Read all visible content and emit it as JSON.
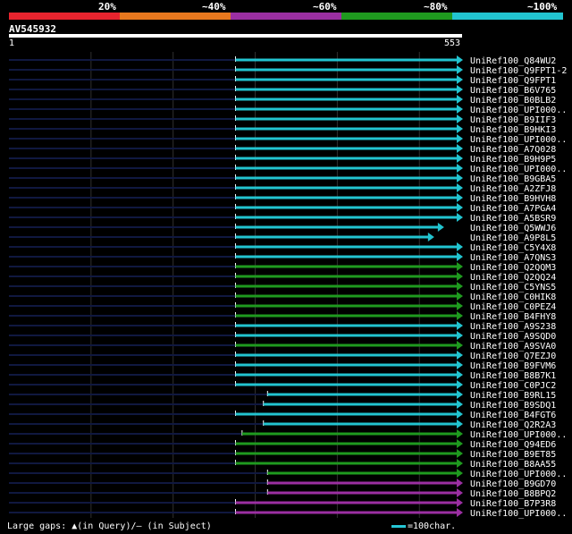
{
  "legend": {
    "segments": [
      {
        "label": "20%",
        "color": "#e8242e"
      },
      {
        "label": "~40%",
        "color": "#e8781e"
      },
      {
        "label": "~60%",
        "color": "#9b2fa2"
      },
      {
        "label": "~80%",
        "color": "#1f9a1f"
      },
      {
        "label": "~100%",
        "color": "#22c4d0"
      }
    ]
  },
  "query": {
    "id": "AV545932",
    "start": "1",
    "end": "553",
    "length": 553
  },
  "colors": {
    "query_line": "#101840",
    "cyan": "#22c4d0",
    "green": "#1f9a1f",
    "purple": "#9b2fa2",
    "grid": "#303030"
  },
  "hits": [
    {
      "name": "UniRef100_Q84WU2",
      "color": "cyan",
      "start": 277,
      "end": 553,
      "arrow": true
    },
    {
      "name": "UniRef100_Q9FPT1-2",
      "color": "cyan",
      "start": 277,
      "end": 553,
      "arrow": true
    },
    {
      "name": "UniRef100_Q9FPT1",
      "color": "cyan",
      "start": 277,
      "end": 553,
      "arrow": true
    },
    {
      "name": "UniRef100_B6V765",
      "color": "cyan",
      "start": 277,
      "end": 553,
      "arrow": true
    },
    {
      "name": "UniRef100_B0BLB2",
      "color": "cyan",
      "start": 277,
      "end": 553,
      "arrow": true
    },
    {
      "name": "UniRef100_UPI000..",
      "color": "cyan",
      "start": 277,
      "end": 553,
      "arrow": true
    },
    {
      "name": "UniRef100_B9IIF3",
      "color": "cyan",
      "start": 277,
      "end": 553,
      "arrow": true
    },
    {
      "name": "UniRef100_B9HKI3",
      "color": "cyan",
      "start": 277,
      "end": 553,
      "arrow": true
    },
    {
      "name": "UniRef100_UPI000..",
      "color": "cyan",
      "start": 277,
      "end": 553,
      "arrow": true
    },
    {
      "name": "UniRef100_A7Q028",
      "color": "cyan",
      "start": 277,
      "end": 553,
      "arrow": true
    },
    {
      "name": "UniRef100_B9H9P5",
      "color": "cyan",
      "start": 277,
      "end": 553,
      "arrow": true
    },
    {
      "name": "UniRef100_UPI000..",
      "color": "cyan",
      "start": 277,
      "end": 553,
      "arrow": true
    },
    {
      "name": "UniRef100_B9GBA5",
      "color": "cyan",
      "start": 277,
      "end": 553,
      "arrow": true
    },
    {
      "name": "UniRef100_A2ZFJ8",
      "color": "cyan",
      "start": 277,
      "end": 553,
      "arrow": true
    },
    {
      "name": "UniRef100_B9HVH8",
      "color": "cyan",
      "start": 277,
      "end": 553,
      "arrow": true
    },
    {
      "name": "UniRef100_A7PGA4",
      "color": "cyan",
      "start": 277,
      "end": 553,
      "arrow": true
    },
    {
      "name": "UniRef100_A5BSR9",
      "color": "cyan",
      "start": 277,
      "end": 553,
      "arrow": true
    },
    {
      "name": "UniRef100_Q5WWJ6",
      "color": "cyan",
      "start": 277,
      "end": 530,
      "arrow": true
    },
    {
      "name": "UniRef100_A9P8L5",
      "color": "cyan",
      "start": 277,
      "end": 518,
      "arrow": true
    },
    {
      "name": "UniRef100_C5Y4X8",
      "color": "cyan",
      "start": 277,
      "end": 553,
      "arrow": true
    },
    {
      "name": "UniRef100_A7QNS3",
      "color": "cyan",
      "start": 277,
      "end": 553,
      "arrow": true
    },
    {
      "name": "UniRef100_Q2QQM3",
      "color": "green",
      "start": 277,
      "end": 553,
      "arrow": true
    },
    {
      "name": "UniRef100_Q2QQ24",
      "color": "green",
      "start": 277,
      "end": 553,
      "arrow": true
    },
    {
      "name": "UniRef100_C5YNS5",
      "color": "green",
      "start": 277,
      "end": 553,
      "arrow": true
    },
    {
      "name": "UniRef100_C0HIK8",
      "color": "green",
      "start": 277,
      "end": 553,
      "arrow": true
    },
    {
      "name": "UniRef100_C0PEZ4",
      "color": "green",
      "start": 277,
      "end": 553,
      "arrow": true
    },
    {
      "name": "UniRef100_B4FHY8",
      "color": "green",
      "start": 277,
      "end": 553,
      "arrow": true
    },
    {
      "name": "UniRef100_A9S238",
      "color": "cyan",
      "start": 277,
      "end": 553,
      "arrow": true
    },
    {
      "name": "UniRef100_A9SQD0",
      "color": "cyan",
      "start": 277,
      "end": 553,
      "arrow": true
    },
    {
      "name": "UniRef100_A9SVA0",
      "color": "green",
      "start": 277,
      "end": 553,
      "arrow": true
    },
    {
      "name": "UniRef100_Q7EZJ0",
      "color": "cyan",
      "start": 277,
      "end": 553,
      "arrow": true
    },
    {
      "name": "UniRef100_B9FVM6",
      "color": "cyan",
      "start": 277,
      "end": 553,
      "arrow": true
    },
    {
      "name": "UniRef100_B8B7K1",
      "color": "cyan",
      "start": 277,
      "end": 553,
      "arrow": true
    },
    {
      "name": "UniRef100_C0PJC2",
      "color": "cyan",
      "start": 277,
      "end": 553,
      "arrow": true
    },
    {
      "name": "UniRef100_B9RL15",
      "color": "cyan",
      "start": 316,
      "end": 553,
      "arrow": true
    },
    {
      "name": "UniRef100_B9SDQ1",
      "color": "cyan",
      "start": 311,
      "end": 553,
      "arrow": true
    },
    {
      "name": "UniRef100_B4FGT6",
      "color": "cyan",
      "start": 277,
      "end": 553,
      "arrow": true
    },
    {
      "name": "UniRef100_Q2R2A3",
      "color": "cyan",
      "start": 311,
      "end": 553,
      "arrow": true
    },
    {
      "name": "UniRef100_UPI000..",
      "color": "green",
      "start": 285,
      "end": 553,
      "arrow": true
    },
    {
      "name": "UniRef100_Q94ED6",
      "color": "green",
      "start": 277,
      "end": 553,
      "arrow": true
    },
    {
      "name": "UniRef100_B9ET85",
      "color": "green",
      "start": 277,
      "end": 553,
      "arrow": true
    },
    {
      "name": "UniRef100_B8AA55",
      "color": "green",
      "start": 277,
      "end": 553,
      "arrow": true
    },
    {
      "name": "UniRef100_UPI000..",
      "color": "green",
      "start": 316,
      "end": 553,
      "arrow": true
    },
    {
      "name": "UniRef100_B9GD70",
      "color": "purple",
      "start": 316,
      "end": 553,
      "arrow": true
    },
    {
      "name": "UniRef100_B8BPQ2",
      "color": "purple",
      "start": 316,
      "end": 553,
      "arrow": true
    },
    {
      "name": "UniRef100_B7P3R8",
      "color": "purple",
      "start": 277,
      "end": 553,
      "arrow": true
    },
    {
      "name": "UniRef100_UPI000..",
      "color": "purple",
      "start": 277,
      "end": 553,
      "arrow": true
    }
  ],
  "footer": {
    "gaps_text": "Large gaps: ▲(in Query)/— (in Subject)",
    "scale_text": "=100char."
  }
}
